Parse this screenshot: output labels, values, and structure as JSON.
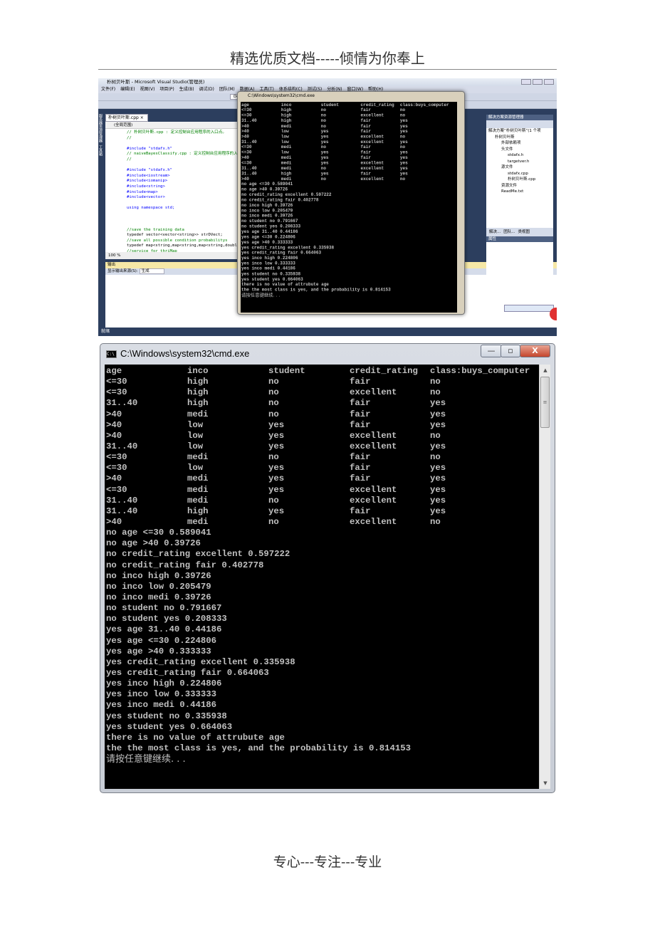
{
  "page": {
    "header": "精选优质文档-----倾情为你奉上",
    "footer": "专心---专注---专业"
  },
  "vs": {
    "title": "朴树贝叶斯 - Microsoft Visual Studio(管理员)",
    "menu": [
      "文件(F)",
      "编辑(E)",
      "视图(V)",
      "项目(P)",
      "生成(B)",
      "调试(D)",
      "团队(M)",
      "数据(A)",
      "工具(T)",
      "体系结构(C)",
      "测试(S)",
      "分析(N)",
      "窗口(W)",
      "帮助(H)"
    ],
    "config": "Debug",
    "side_tabs": [
      "服务器资源管理器",
      "工具箱"
    ],
    "tab": "朴树贝叶斯.cpp",
    "scope": "(全局范围)",
    "code": [
      {
        "t": "// 朴树贝叶斯.cpp : 定义控制台应用程序的入口点。",
        "k": "c-cmt"
      },
      {
        "t": "//",
        "k": "c-cmt"
      },
      {
        "t": "",
        "k": ""
      },
      {
        "t": "#include \"stdafx.h\"",
        "k": "c-kw"
      },
      {
        "t": "// naiveBayesClassify.cpp : 定义控制台应用程序的入口点",
        "k": "c-cmt"
      },
      {
        "t": "//",
        "k": "c-cmt"
      },
      {
        "t": "",
        "k": ""
      },
      {
        "t": "#include \"stdafx.h\"",
        "k": "c-kw"
      },
      {
        "t": "#include<iostream>",
        "k": "c-kw"
      },
      {
        "t": "#include<iomanip>",
        "k": "c-kw"
      },
      {
        "t": "#include<string>",
        "k": "c-kw"
      },
      {
        "t": "#include<map>",
        "k": "c-kw"
      },
      {
        "t": "#include<vector>",
        "k": "c-kw"
      },
      {
        "t": "",
        "k": ""
      },
      {
        "t": "using namespace std;",
        "k": "c-kw"
      },
      {
        "t": "",
        "k": ""
      },
      {
        "t": "",
        "k": ""
      },
      {
        "t": "",
        "k": ""
      },
      {
        "t": "//save the training data",
        "k": "c-cmt"
      },
      {
        "t": "typedef vector<vector<string>> strDVect;",
        "k": ""
      },
      {
        "t": "//save all possible condition probabilitys",
        "k": "c-cmt"
      },
      {
        "t": "typedef map<string,map<string,map<string,double>>>",
        "k": ""
      },
      {
        "t": "//service for thriMap",
        "k": "c-cmt"
      }
    ],
    "zoom": "100 %",
    "output": {
      "title": "输出",
      "source_label": "显示输出来源(S):",
      "source_value": "生成"
    },
    "status": "就绪",
    "solution": {
      "title": "解决方案资源管理器",
      "items": [
        {
          "label": "解决方案“朴树贝叶斯”(1 个项",
          "indent": 0
        },
        {
          "label": "朴树贝叶斯",
          "indent": 1
        },
        {
          "label": "外部依赖项",
          "indent": 2
        },
        {
          "label": "头文件",
          "indent": 2
        },
        {
          "label": "stdafx.h",
          "indent": 3
        },
        {
          "label": "targetver.h",
          "indent": 3
        },
        {
          "label": "源文件",
          "indent": 2
        },
        {
          "label": "stdafx.cpp",
          "indent": 3
        },
        {
          "label": "朴树贝叶斯.cpp",
          "indent": 3
        },
        {
          "label": "资源文件",
          "indent": 2
        },
        {
          "label": "ReadMe.txt",
          "indent": 2
        }
      ],
      "tabs": [
        "解决...",
        "团队...",
        "类视图"
      ]
    },
    "properties_title": "属性"
  },
  "cmd": {
    "title": "C:\\Windows\\system32\\cmd.exe",
    "table_header": [
      "age",
      "inco",
      "student",
      "credit_rating",
      "class:buys_computer"
    ],
    "table_rows": [
      [
        "<=30",
        "high",
        "no",
        "fair",
        "no"
      ],
      [
        "<=30",
        "high",
        "no",
        "excellent",
        "no"
      ],
      [
        "31..40",
        "high",
        "no",
        "fair",
        "yes"
      ],
      [
        ">40",
        "medi",
        "no",
        "fair",
        "yes"
      ],
      [
        ">40",
        "low",
        "yes",
        "fair",
        "yes"
      ],
      [
        ">40",
        "low",
        "yes",
        "excellent",
        "no"
      ],
      [
        "31..40",
        "low",
        "yes",
        "excellent",
        "yes"
      ],
      [
        "<=30",
        "medi",
        "no",
        "fair",
        "no"
      ],
      [
        "<=30",
        "low",
        "yes",
        "fair",
        "yes"
      ],
      [
        ">40",
        "medi",
        "yes",
        "fair",
        "yes"
      ],
      [
        "<=30",
        "medi",
        "yes",
        "excellent",
        "yes"
      ],
      [
        "31..40",
        "medi",
        "no",
        "excellent",
        "yes"
      ],
      [
        "31..40",
        "high",
        "yes",
        "fair",
        "yes"
      ],
      [
        ">40",
        "medi",
        "no",
        "excellent",
        "no"
      ]
    ],
    "probabilities": [
      "no age <=30 0.589041",
      "no age >40 0.39726",
      "no credit_rating excellent 0.597222",
      "no credit_rating fair 0.402778",
      "no inco high 0.39726",
      "no inco low 0.205479",
      "no inco medi 0.39726",
      "no student no 0.791667",
      "no student yes 0.208333",
      "yes age 31..40 0.44186",
      "yes age <=30 0.224806",
      "yes age >40 0.333333",
      "yes credit_rating excellent 0.335938",
      "yes credit_rating fair 0.664063",
      "yes inco high 0.224806",
      "yes inco low 0.333333",
      "yes inco medi 0.44186",
      "yes student no 0.335938",
      "yes student yes 0.664063"
    ],
    "messages": [
      "there is no value of attrubute age",
      "the the most class is yes, and the probability is 0.814153"
    ],
    "prompt": "请按任意键继续. . ."
  }
}
